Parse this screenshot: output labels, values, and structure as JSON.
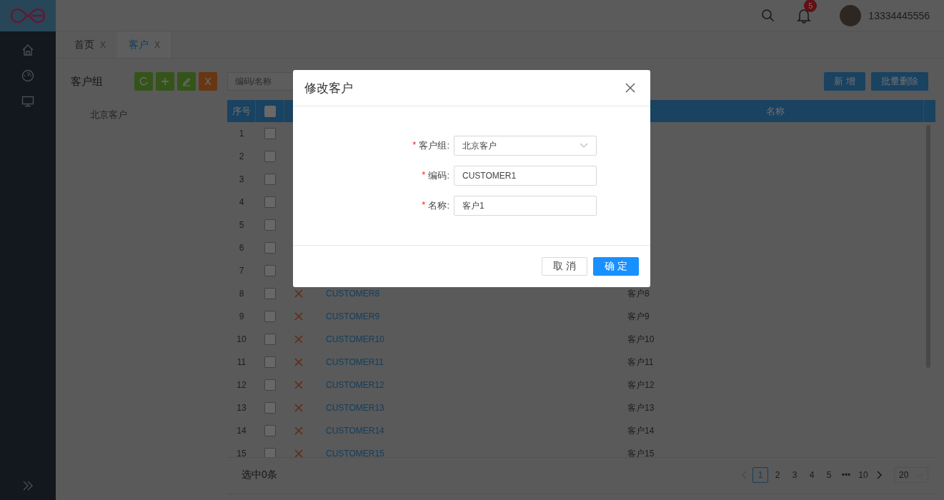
{
  "header": {
    "notification_count": "5",
    "username": "13334445556"
  },
  "tabs": [
    {
      "label": "首页",
      "close": "X",
      "selected": false
    },
    {
      "label": "客户",
      "close": "X",
      "selected": true
    }
  ],
  "customer_groups": {
    "title": "客户组",
    "tools": [
      {
        "kind": "refresh"
      },
      {
        "kind": "add"
      },
      {
        "kind": "edit"
      },
      {
        "kind": "delete",
        "label": "X"
      }
    ],
    "items": [
      {
        "label": "北京客户",
        "selected": false
      }
    ]
  },
  "search": {
    "placeholder": "编码/名称"
  },
  "actions": [
    {
      "label": "新 增"
    },
    {
      "label": "批量删除"
    }
  ],
  "table": {
    "columns": {
      "index": "序号",
      "name": "名称"
    },
    "select_all_checked": false,
    "rows": [
      {
        "index": "1",
        "checked": false
      },
      {
        "index": "2",
        "checked": false
      },
      {
        "index": "3",
        "checked": false
      },
      {
        "index": "4",
        "checked": false
      },
      {
        "index": "5",
        "checked": false
      },
      {
        "index": "6",
        "checked": false
      },
      {
        "index": "7",
        "checked": false
      },
      {
        "index": "8",
        "checked": false,
        "code": "CUSTOMER8",
        "name": "客户8"
      },
      {
        "index": "9",
        "checked": false,
        "code": "CUSTOMER9",
        "name": "客户9"
      },
      {
        "index": "10",
        "checked": false,
        "code": "CUSTOMER10",
        "name": "客户10"
      },
      {
        "index": "11",
        "checked": false,
        "code": "CUSTOMER11",
        "name": "客户11"
      },
      {
        "index": "12",
        "checked": false,
        "code": "CUSTOMER12",
        "name": "客户12"
      },
      {
        "index": "13",
        "checked": false,
        "code": "CUSTOMER13",
        "name": "客户13"
      },
      {
        "index": "14",
        "checked": false,
        "code": "CUSTOMER14",
        "name": "客户14"
      },
      {
        "index": "15",
        "checked": false,
        "code": "CUSTOMER15",
        "name": "客户15"
      }
    ]
  },
  "footer": {
    "selection": "选中0条"
  },
  "pagination": {
    "pages": [
      {
        "label": "1",
        "selected": true
      },
      {
        "label": "2",
        "selected": false
      },
      {
        "label": "3",
        "selected": false
      },
      {
        "label": "4",
        "selected": false
      },
      {
        "label": "5",
        "selected": false
      },
      {
        "label": "•••",
        "selected": false
      },
      {
        "label": "10",
        "selected": false
      }
    ],
    "page_size": "20"
  },
  "modal": {
    "title": "修改客户",
    "fields": [
      {
        "kind": "select",
        "label": "客户组:",
        "required_mark": "*",
        "value": "北京客户"
      },
      {
        "kind": "input",
        "label": "编码:",
        "required_mark": "*",
        "value": "CUSTOMER1"
      },
      {
        "kind": "input",
        "label": "名称:",
        "required_mark": "*",
        "value": "客户1"
      }
    ],
    "buttons": [
      {
        "label": "取 消",
        "kind": "default"
      },
      {
        "label": "确 定",
        "kind": "primary"
      }
    ]
  }
}
